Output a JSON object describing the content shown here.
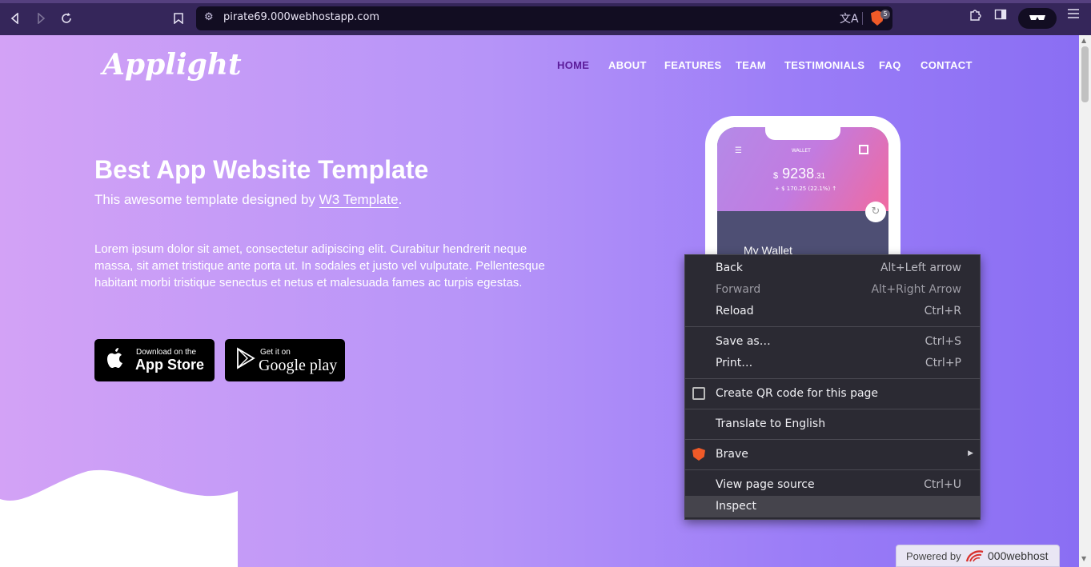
{
  "browser": {
    "url": "pirate69.000webhostapp.com",
    "shield_count": "5",
    "icons": {
      "back": "back-arrow-icon",
      "forward": "forward-arrow-icon",
      "reload": "reload-icon",
      "bookmark": "bookmark-icon",
      "site_settings": "site-settings-icon",
      "translate": "translate-icon",
      "brave_shields": "brave-shield-icon",
      "extensions": "puzzle-icon",
      "sidebar": "sidebar-icon",
      "vpn": "sunglasses-icon",
      "menu": "hamburger-icon"
    }
  },
  "site": {
    "logo": "Applight",
    "nav": [
      "HOME",
      "ABOUT",
      "FEATURES",
      "TEAM",
      "TESTIMONIALS",
      "FAQ",
      "CONTACT"
    ],
    "active_nav": "HOME",
    "hero": {
      "title": "Best App Website Template",
      "subtitle_prefix": "This awesome template designed by ",
      "subtitle_link": "W3 Template",
      "subtitle_suffix": ".",
      "body": "Lorem ipsum dolor sit amet, consectetur adipiscing elit. Curabitur hendrerit neque massa, sit amet tristique ante porta ut. In sodales et justo vel vulputate. Pellentesque habitant morbi tristique senectus et netus et malesuada fames ac turpis egestas."
    },
    "app_store": {
      "small": "Download on the",
      "big": "App Store"
    },
    "google_play": {
      "small": "Get it on",
      "big": "Google play"
    },
    "phone": {
      "wallet_label": "WALLET",
      "amount_currency": "$",
      "amount_main": "9238",
      "amount_cents": ".31",
      "delta": "+ $ 170.25 (22.1%) ↑",
      "section": "My Wallet"
    }
  },
  "context_menu": {
    "items": [
      {
        "label": "Back",
        "shortcut": "Alt+Left arrow",
        "enabled": true
      },
      {
        "label": "Forward",
        "shortcut": "Alt+Right Arrow",
        "enabled": false
      },
      {
        "label": "Reload",
        "shortcut": "Ctrl+R",
        "enabled": true
      },
      {
        "label": "Save as…",
        "shortcut": "Ctrl+S",
        "enabled": true
      },
      {
        "label": "Print…",
        "shortcut": "Ctrl+P",
        "enabled": true
      },
      {
        "label": "Create QR code for this page",
        "shortcut": "",
        "enabled": true,
        "icon": "qr-code-icon"
      },
      {
        "label": "Translate to English",
        "shortcut": "",
        "enabled": true
      },
      {
        "label": "Brave",
        "shortcut": "",
        "enabled": true,
        "icon": "brave-lion-icon",
        "submenu": true
      },
      {
        "label": "View page source",
        "shortcut": "Ctrl+U",
        "enabled": true
      },
      {
        "label": "Inspect",
        "shortcut": "",
        "enabled": true,
        "highlighted": true
      }
    ]
  },
  "footer_badge": {
    "prefix": "Powered by",
    "brand": "000webhost"
  }
}
